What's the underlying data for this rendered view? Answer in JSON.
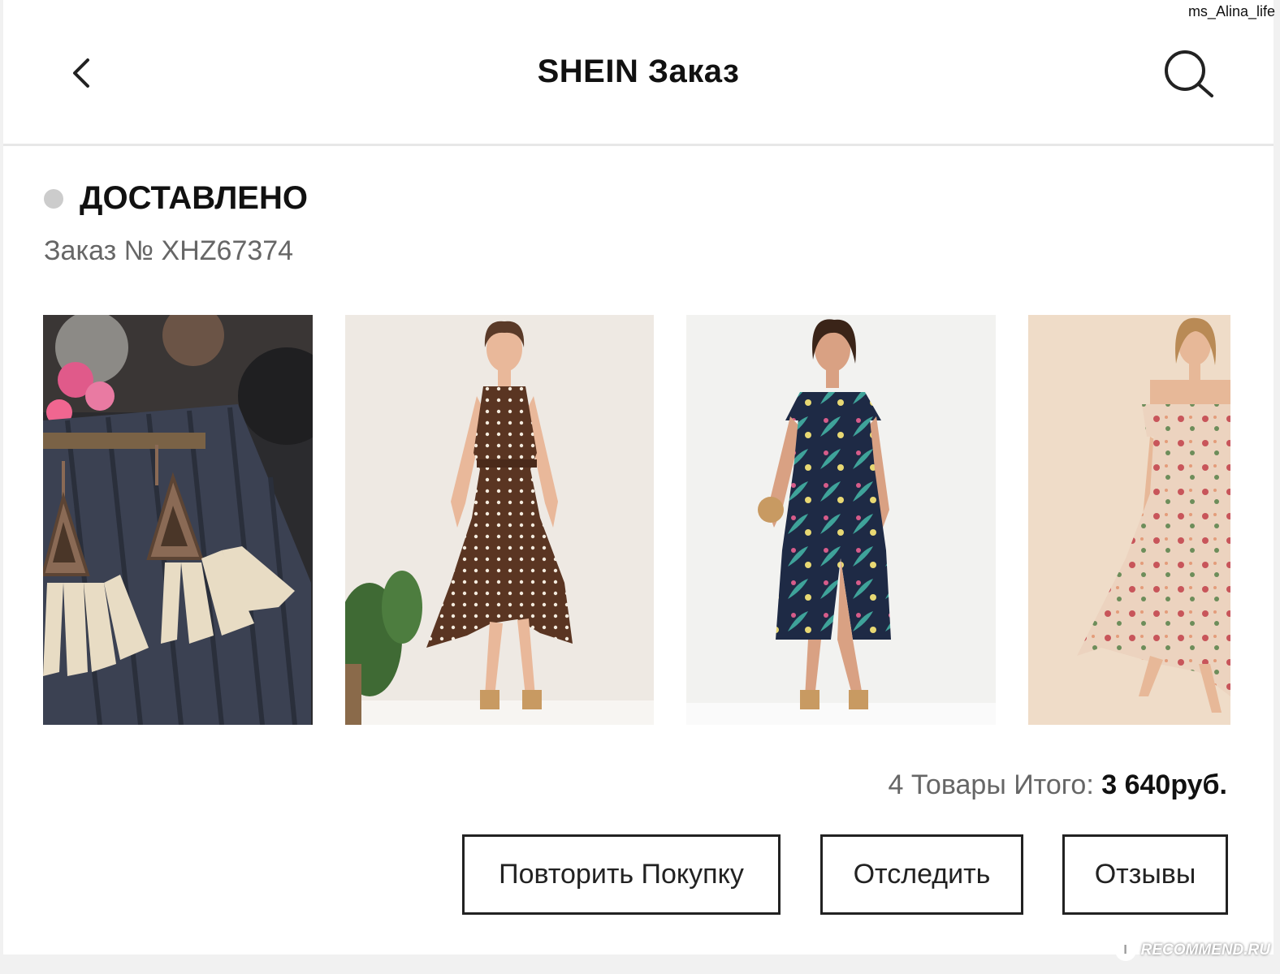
{
  "watermark": {
    "user": "ms_Alina_life",
    "site": "RECOMMEND.RU",
    "badge_letter": "I"
  },
  "header": {
    "title": "SHEIN Заказ",
    "back_icon": "chevron-left-icon",
    "search_icon": "search-icon"
  },
  "order": {
    "status": "ДОСТАВЛЕНО",
    "status_color": "#cccccc",
    "number_text": "Заказ № XHZ67374"
  },
  "products": [
    {
      "type": "earrings",
      "icon": "tassel-earrings-image"
    },
    {
      "type": "dress",
      "icon": "polka-dot-dress-image"
    },
    {
      "type": "dress",
      "icon": "tropical-print-dress-image"
    },
    {
      "type": "dress",
      "icon": "floral-off-shoulder-dress-image"
    }
  ],
  "summary": {
    "count_label": "4 Товары Итого:",
    "total": "3 640руб."
  },
  "actions": {
    "repeat": "Повторить Покупку",
    "track": "Отследить",
    "reviews": "Отзывы"
  }
}
